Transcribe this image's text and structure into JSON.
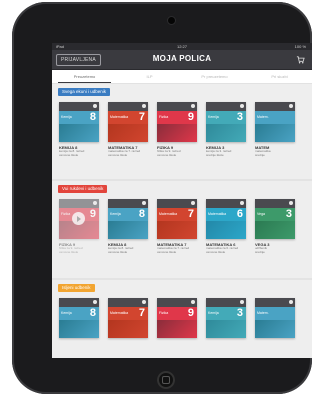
{
  "status_bar": {
    "left": "iPad",
    "time": "12:27",
    "right": "100 %"
  },
  "header": {
    "left_button": "PRIJAVLJENA",
    "title": "MOJA POLICA",
    "right_icon": "cart-icon"
  },
  "tabs": [
    {
      "label": "Preuzetemo",
      "active": true
    },
    {
      "label": "ILP",
      "active": false
    },
    {
      "label": "Pr preuzetemo",
      "active": false
    },
    {
      "label": "Pri sluzbi",
      "active": false
    }
  ],
  "sections": [
    {
      "label": "Svega ekuni i udbenik",
      "color": "#3a7cc2",
      "books": [
        {
          "cover_name": "Kemija",
          "num": "8",
          "band": "#4aa3c4",
          "bottom": "#2a7c93",
          "title": "KEMIJA 8",
          "sub1": "kemija za 8. razred",
          "sub2": "osnovne škole"
        },
        {
          "cover_name": "Matematika",
          "num": "7",
          "band": "#d2452f",
          "bottom": "#b3361f",
          "title": "MATEMATIKA 7",
          "sub1": "matematika za 7. razred",
          "sub2": "osnovne škole"
        },
        {
          "cover_name": "Fizika",
          "num": "9",
          "band": "#e0374a",
          "bottom": "#8a2d3b",
          "title": "FIZIKA 9",
          "sub1": "fizika za 9. razred",
          "sub2": "osnovne škole"
        },
        {
          "cover_name": "Kemija",
          "num": "3",
          "band": "#43aab8",
          "bottom": "#2f8a9a",
          "title": "KEMIJA 3",
          "sub1": "kemija za 3. razred",
          "sub2": "srednje škole"
        },
        {
          "cover_name": "Matem.",
          "num": "",
          "band": "#4aa3c4",
          "bottom": "#2a7c93",
          "title": "MATEM",
          "sub1": "matematika",
          "sub2": "srednje"
        }
      ]
    },
    {
      "label": "Vui rukdevi i udbenik",
      "color": "#e2453c",
      "books": [
        {
          "cover_name": "Fizika",
          "num": "9",
          "band": "#e0374a",
          "bottom": "#8a2d3b",
          "title": "FIZIKA 9",
          "sub1": "fizika za 9. razred",
          "sub2": "osnovne škole",
          "faded": true,
          "play": true
        },
        {
          "cover_name": "Kemija",
          "num": "8",
          "band": "#4aa3c4",
          "bottom": "#2a7c93",
          "title": "KEMIJA 8",
          "sub1": "kemija za 8. razred",
          "sub2": "osnovne škole"
        },
        {
          "cover_name": "Matematika",
          "num": "7",
          "band": "#d2452f",
          "bottom": "#b3361f",
          "title": "MATEMATIKA 7",
          "sub1": "matematika za 7. razred",
          "sub2": "osnovne škole"
        },
        {
          "cover_name": "Matematika",
          "num": "6",
          "band": "#2ca7c9",
          "bottom": "#2388a8",
          "title": "MATEMATIKA 6",
          "sub1": "matematika za 6. razred",
          "sub2": "osnovne škole"
        },
        {
          "cover_name": "Vega",
          "num": "3",
          "band": "#3d9a6a",
          "bottom": "#2b7a52",
          "title": "VEGA 3",
          "sub1": "udžbenik",
          "sub2": "srednje"
        }
      ]
    },
    {
      "label": "Isljeni udbenik",
      "color": "#f2a531",
      "books": [
        {
          "cover_name": "Kemija",
          "num": "8",
          "band": "#4aa3c4",
          "bottom": "#2a7c93",
          "title": "",
          "sub1": "",
          "sub2": ""
        },
        {
          "cover_name": "Matematika",
          "num": "7",
          "band": "#d2452f",
          "bottom": "#b3361f",
          "title": "",
          "sub1": "",
          "sub2": ""
        },
        {
          "cover_name": "Fizika",
          "num": "9",
          "band": "#e0374a",
          "bottom": "#8a2d3b",
          "title": "",
          "sub1": "",
          "sub2": ""
        },
        {
          "cover_name": "Kemija",
          "num": "3",
          "band": "#43aab8",
          "bottom": "#2f8a9a",
          "title": "",
          "sub1": "",
          "sub2": ""
        },
        {
          "cover_name": "Matem.",
          "num": "",
          "band": "#4aa3c4",
          "bottom": "#2a7c93",
          "title": "",
          "sub1": "",
          "sub2": ""
        }
      ]
    }
  ]
}
